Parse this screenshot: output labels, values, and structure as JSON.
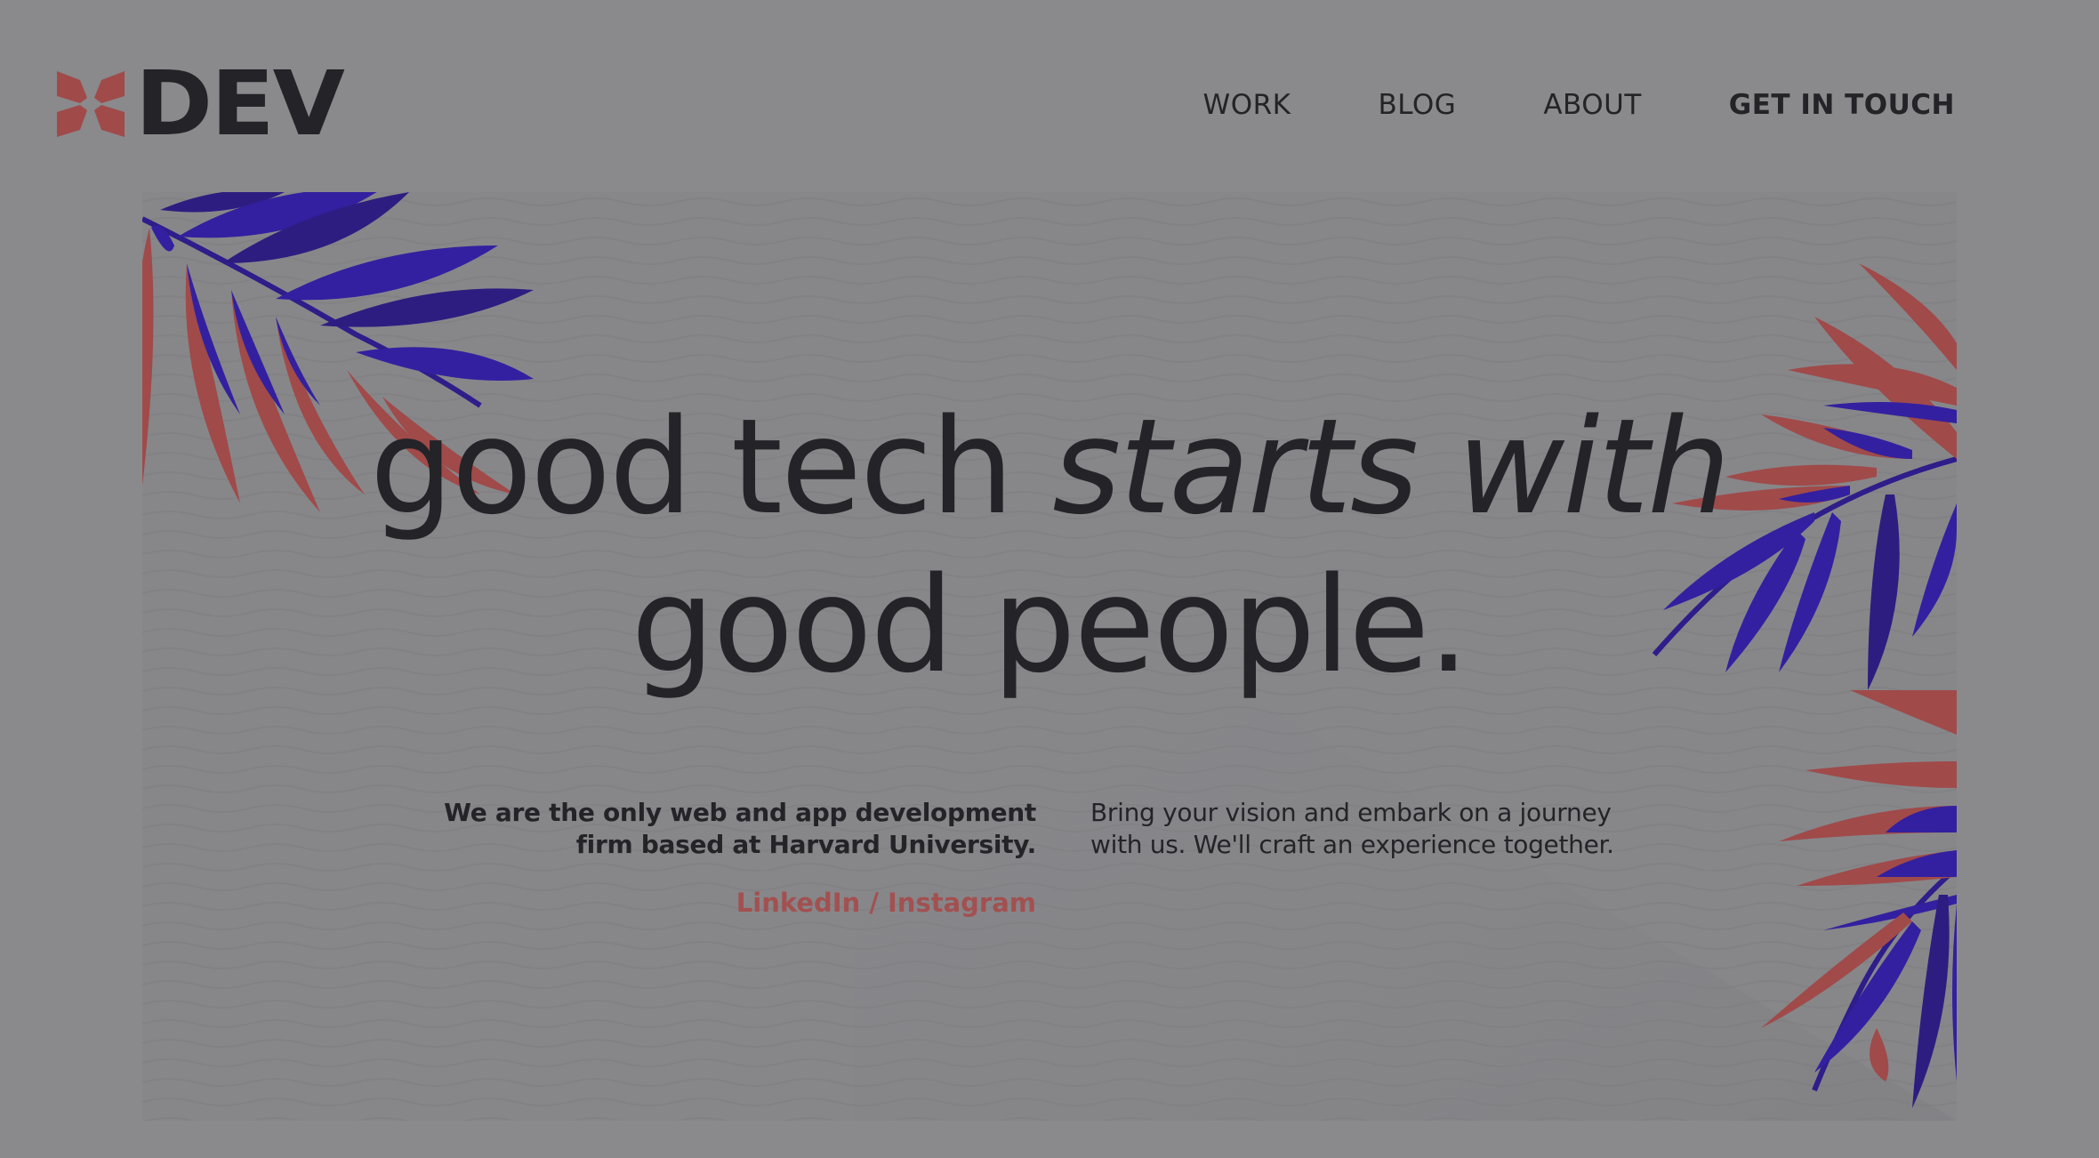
{
  "brand": {
    "name": "DEV",
    "logo_icon": "butterfly-logo-icon"
  },
  "nav": {
    "items": [
      {
        "label": "WORK"
      },
      {
        "label": "BLOG"
      },
      {
        "label": "ABOUT"
      },
      {
        "label": "GET IN TOUCH"
      }
    ]
  },
  "hero": {
    "headline_part1": "good tech ",
    "headline_part2": "starts with",
    "headline_line2": "good people.",
    "intro_bold_line1": "We are the only web and app development",
    "intro_bold_line2": "firm based at Harvard University.",
    "social_link": "LinkedIn / Instagram",
    "tagline_line1": "Bring your vision and embark on a journey",
    "tagline_line2": "with us. We'll craft an experience together."
  },
  "colors": {
    "background": "#8a8a8c",
    "text": "#232328",
    "accent_red": "#a35050",
    "leaf_red": "#a04a4a",
    "leaf_blue": "#3320a0"
  }
}
